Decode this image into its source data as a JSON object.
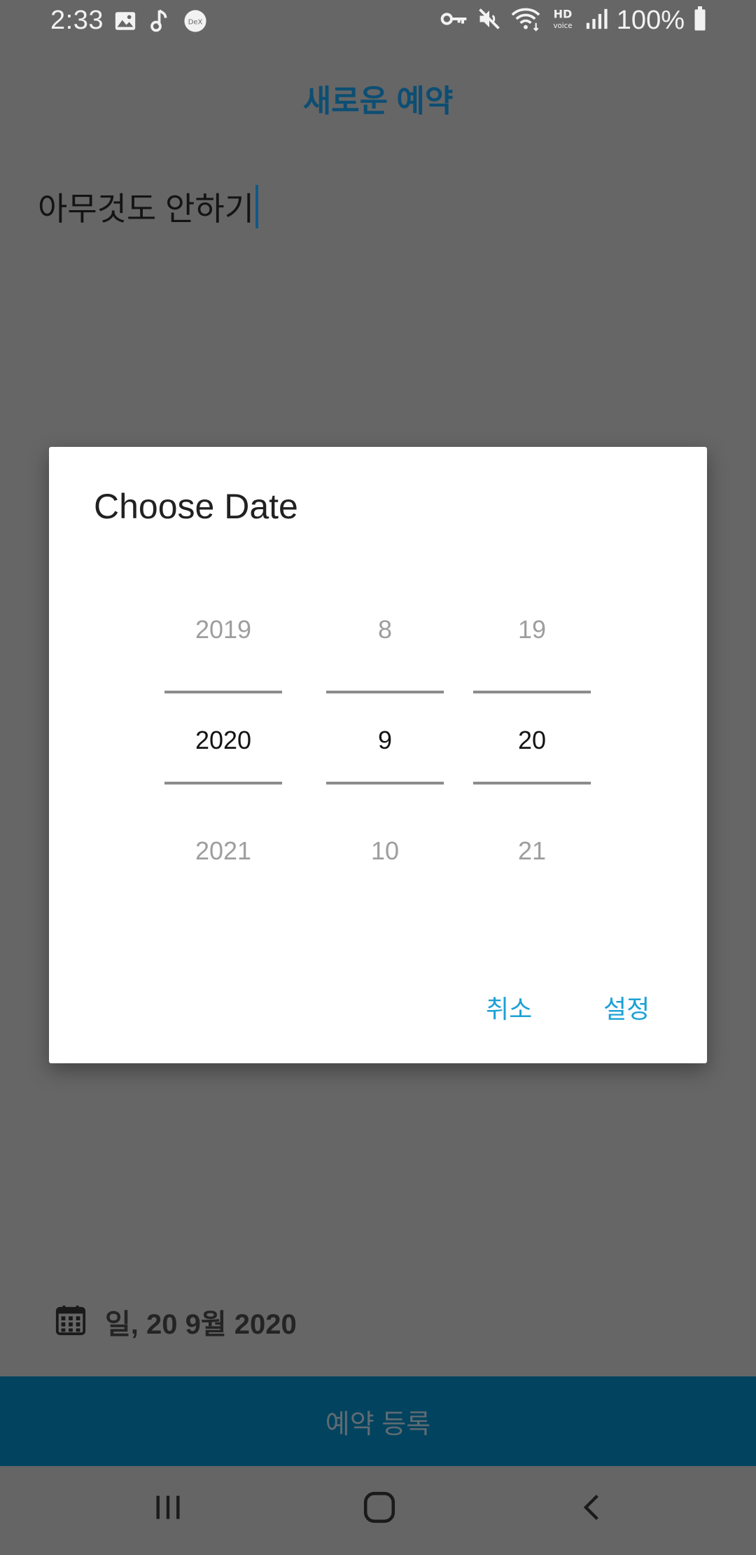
{
  "status_bar": {
    "time": "2:33",
    "battery": "100%",
    "icons": [
      "image-icon",
      "music-note-icon",
      "dex-icon",
      "key-icon",
      "mute-icon",
      "wifi-icon",
      "hd-voice-icon",
      "signal-icon",
      "battery-icon"
    ]
  },
  "app": {
    "title": "새로운 예약",
    "memo_text": "아무것도 안하기",
    "accent_color": "#0d4e73"
  },
  "date_row": {
    "icon": "calendar-icon",
    "text": "일, 20 9월 2020"
  },
  "action_bar": {
    "label": "예약 등록",
    "background": "#02435f"
  },
  "dialog": {
    "title": "Choose Date",
    "year": {
      "prev": "2019",
      "current": "2020",
      "next": "2021"
    },
    "month": {
      "prev": "8",
      "current": "9",
      "next": "10"
    },
    "day": {
      "prev": "19",
      "current": "20",
      "next": "21"
    },
    "cancel_label": "취소",
    "confirm_label": "설정",
    "button_color": "#1ba1d6"
  },
  "nav_bar": {
    "icons": [
      "recent-apps-icon",
      "home-icon",
      "back-icon"
    ]
  }
}
